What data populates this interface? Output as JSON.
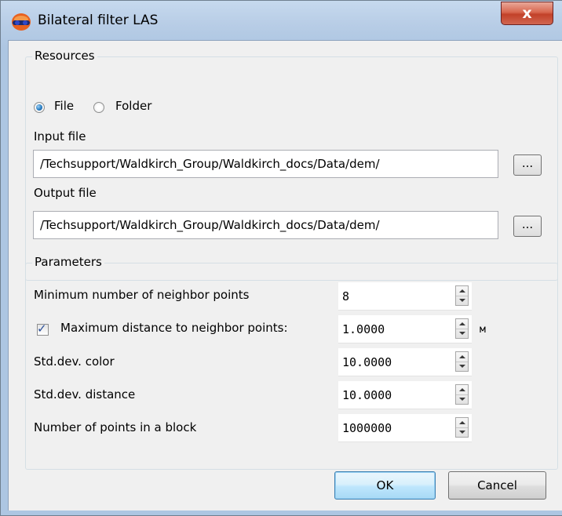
{
  "window": {
    "title": "Bilateral filter LAS",
    "close_label": "x"
  },
  "resources": {
    "title": "Resources",
    "source_options": [
      {
        "label": "File",
        "selected": true
      },
      {
        "label": "Folder",
        "selected": false
      }
    ],
    "input_label": "Input file",
    "input_value": "/Techsupport/Waldkirch_Group/Waldkirch_docs/Data/dem/",
    "output_label": "Output file",
    "output_value": "/Techsupport/Waldkirch_Group/Waldkirch_docs/Data/dem/",
    "browse_label": "..."
  },
  "parameters": {
    "title": "Parameters",
    "rows": [
      {
        "label": "Minimum number of neighbor points",
        "value": "8",
        "unit": ""
      },
      {
        "label": "Maximum distance to neighbor points:",
        "value": "1.0000",
        "unit": "м",
        "checkbox": true,
        "checked": true
      },
      {
        "label": "Std.dev. color",
        "value": "10.0000",
        "unit": ""
      },
      {
        "label": "Std.dev. distance",
        "value": "10.0000",
        "unit": ""
      },
      {
        "label": "Number of points in a block",
        "value": "1000000",
        "unit": ""
      }
    ]
  },
  "buttons": {
    "ok": "OK",
    "cancel": "Cancel"
  }
}
